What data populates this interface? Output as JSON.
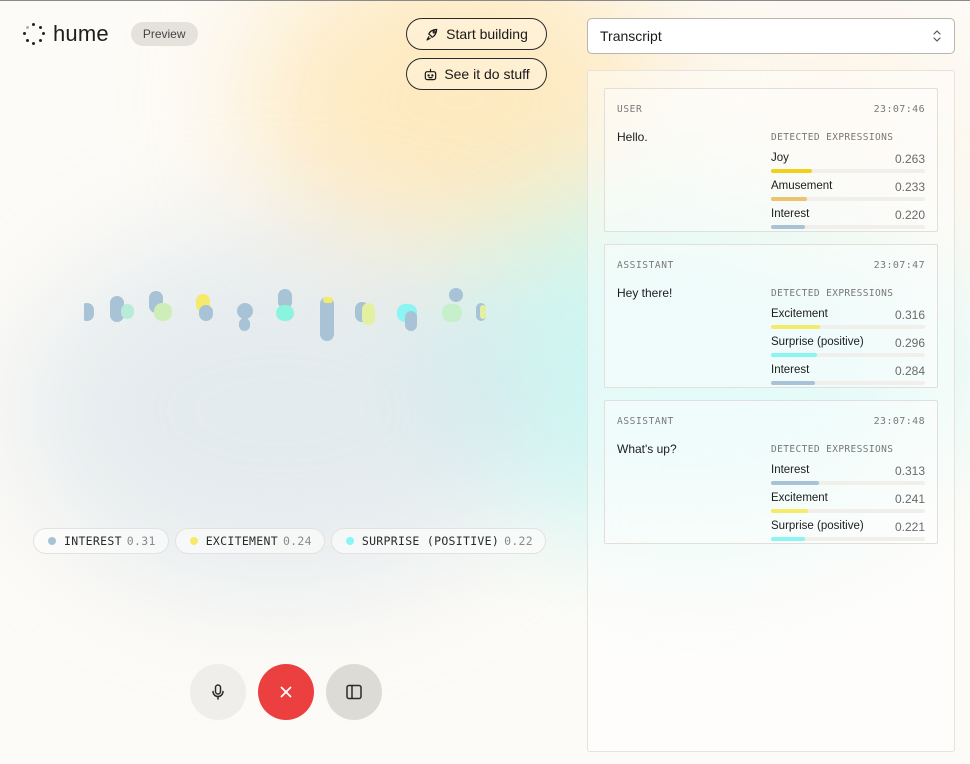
{
  "brand": {
    "name": "hume",
    "badge": "Preview"
  },
  "header": {
    "start_building": "Start building",
    "see_it_do_stuff": "See it do stuff"
  },
  "colors": {
    "interest": "#a8c3d6",
    "excitement": "#f5ea6a",
    "surprise_positive": "#8af5f2",
    "joy": "#f0d21c",
    "amusement": "#ecc36e",
    "end_call": "#ec3f3f"
  },
  "chips": [
    {
      "label": "INTEREST",
      "value": "0.31",
      "color": "#a8c3d6"
    },
    {
      "label": "EXCITEMENT",
      "value": "0.24",
      "color": "#f5ea6a"
    },
    {
      "label": "SURPRISE (POSITIVE)",
      "value": "0.22",
      "color": "#8af5f2"
    }
  ],
  "controls": {
    "mic": "mic-icon",
    "end": "close-icon",
    "panel": "sidebar-icon"
  },
  "view_select": {
    "value": "Transcript"
  },
  "transcript": [
    {
      "role": "USER",
      "time": "23:07:46",
      "message": "Hello.",
      "expressions_title": "DETECTED EXPRESSIONS",
      "expressions": [
        {
          "name": "Joy",
          "value": "0.263",
          "color": "#f0d21c"
        },
        {
          "name": "Amusement",
          "value": "0.233",
          "color": "#ecc36e"
        },
        {
          "name": "Interest",
          "value": "0.220",
          "color": "#a8c3d6"
        }
      ]
    },
    {
      "role": "ASSISTANT",
      "time": "23:07:47",
      "message": "Hey there!",
      "expressions_title": "DETECTED EXPRESSIONS",
      "expressions": [
        {
          "name": "Excitement",
          "value": "0.316",
          "color": "#f5ea6a"
        },
        {
          "name": "Surprise (positive)",
          "value": "0.296",
          "color": "#8af5f2"
        },
        {
          "name": "Interest",
          "value": "0.284",
          "color": "#a8c3d6"
        }
      ]
    },
    {
      "role": "ASSISTANT",
      "time": "23:07:48",
      "message": "What's up?",
      "expressions_title": "DETECTED EXPRESSIONS",
      "expressions": [
        {
          "name": "Interest",
          "value": "0.313",
          "color": "#a8c3d6"
        },
        {
          "name": "Excitement",
          "value": "0.241",
          "color": "#f5ea6a"
        },
        {
          "name": "Surprise (positive)",
          "value": "0.221",
          "color": "#8af5f2"
        }
      ]
    }
  ]
}
